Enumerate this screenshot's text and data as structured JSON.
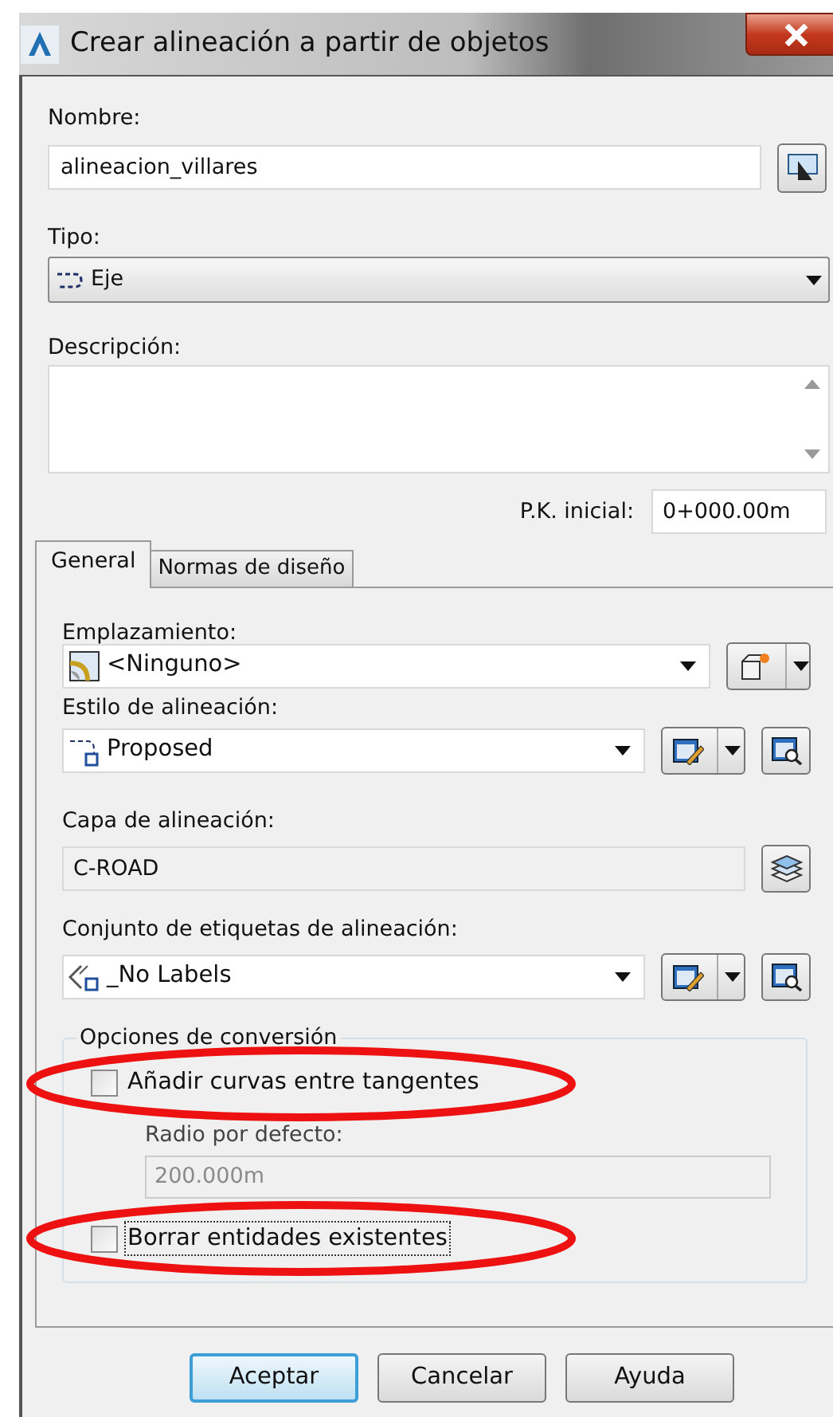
{
  "window": {
    "title": "Crear alineación a partir de objetos"
  },
  "name_field": {
    "label": "Nombre:",
    "value": "alineacion_villares"
  },
  "type_field": {
    "label": "Tipo:",
    "value": "Eje"
  },
  "description_field": {
    "label": "Descripción:"
  },
  "start_station": {
    "label": "P.K. inicial:",
    "value": "0+000.00m"
  },
  "tabs": [
    {
      "label": "General",
      "selected": true
    },
    {
      "label": "Normas de diseño",
      "selected": false
    }
  ],
  "general": {
    "site": {
      "label": "Emplazamiento:",
      "value": "<Ninguno>"
    },
    "style": {
      "label": "Estilo de alineación:",
      "value": "Proposed"
    },
    "layer": {
      "label": "Capa de alineación:",
      "value": "C-ROAD"
    },
    "label_set": {
      "label": "Conjunto de etiquetas de alineación:",
      "value": "_No Labels"
    },
    "conversion": {
      "title": "Opciones de conversión",
      "add_curves": {
        "label": "Añadir curvas entre tangentes",
        "checked": false
      },
      "default_radius": {
        "label": "Radio por defecto:",
        "value": "200.000m",
        "disabled": true
      },
      "erase_existing": {
        "label": "Borrar entidades existentes",
        "checked": false,
        "focused": true
      }
    }
  },
  "buttons": [
    {
      "label": "Aceptar",
      "default": true
    },
    {
      "label": "Cancelar",
      "default": false
    },
    {
      "label": "Ayuda",
      "default": false
    }
  ]
}
